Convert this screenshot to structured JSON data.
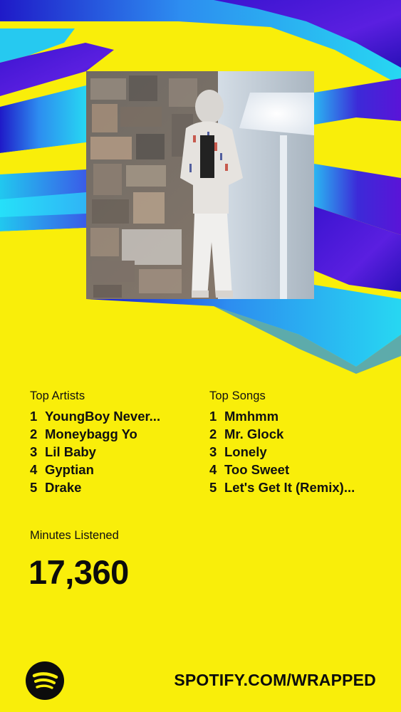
{
  "top_artists": {
    "heading": "Top Artists",
    "items": [
      {
        "rank": "1",
        "name": "YoungBoy Never..."
      },
      {
        "rank": "2",
        "name": "Moneybagg Yo"
      },
      {
        "rank": "3",
        "name": "Lil Baby"
      },
      {
        "rank": "4",
        "name": "Gyptian"
      },
      {
        "rank": "5",
        "name": "Drake"
      }
    ]
  },
  "top_songs": {
    "heading": "Top Songs",
    "items": [
      {
        "rank": "1",
        "name": "Mmhmm"
      },
      {
        "rank": "2",
        "name": "Mr. Glock"
      },
      {
        "rank": "3",
        "name": "Lonely"
      },
      {
        "rank": "4",
        "name": "Too Sweet"
      },
      {
        "rank": "5",
        "name": "Let's Get It (Remix)..."
      }
    ]
  },
  "minutes": {
    "label": "Minutes Listened",
    "value": "17,360"
  },
  "footer": {
    "url": "SPOTIFY.COM/WRAPPED",
    "logo_icon": "spotify-logo-icon"
  },
  "colors": {
    "background": "#f9ee0a",
    "text": "#111111",
    "accent_blue": "#2fd3f0",
    "accent_purple": "#4b1bd6"
  }
}
